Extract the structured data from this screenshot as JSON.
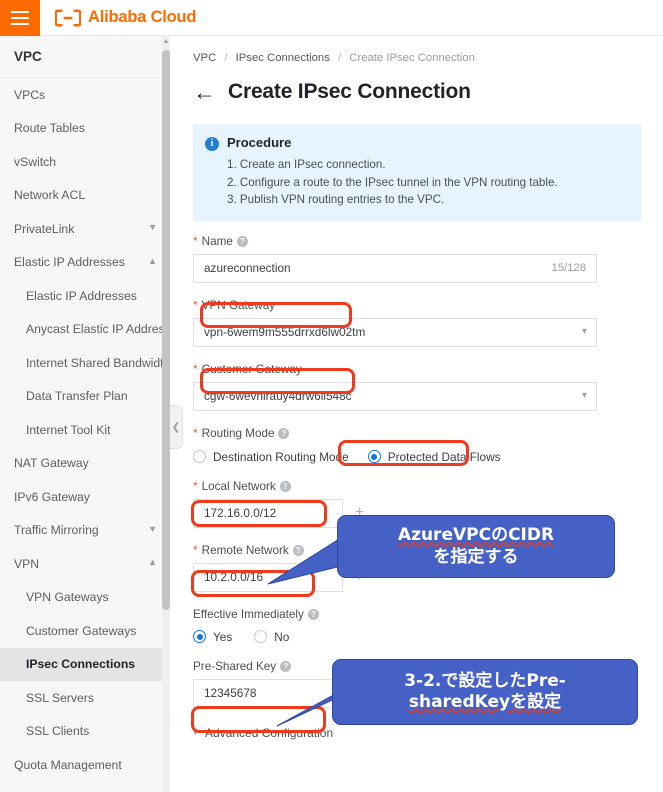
{
  "topbar": {
    "menu_icon": "hamburger-icon",
    "logo_icon": "alibaba-cloud-logo",
    "brand": "Alibaba Cloud"
  },
  "sidebar": {
    "title": "VPC",
    "items": [
      {
        "label": "VPCs",
        "level": 1,
        "expandable": false,
        "active": false
      },
      {
        "label": "Route Tables",
        "level": 1,
        "expandable": false,
        "active": false
      },
      {
        "label": "vSwitch",
        "level": 1,
        "expandable": false,
        "active": false
      },
      {
        "label": "Network ACL",
        "level": 1,
        "expandable": false,
        "active": false
      },
      {
        "label": "PrivateLink",
        "level": 1,
        "expandable": true,
        "expanded": false,
        "active": false
      },
      {
        "label": "Elastic IP Addresses",
        "level": 1,
        "expandable": true,
        "expanded": true,
        "active": false
      },
      {
        "label": "Elastic IP Addresses",
        "level": 2,
        "expandable": false,
        "active": false
      },
      {
        "label": "Anycast Elastic IP Addresses",
        "level": 2,
        "expandable": false,
        "active": false
      },
      {
        "label": "Internet Shared Bandwidth",
        "level": 2,
        "expandable": false,
        "active": false
      },
      {
        "label": "Data Transfer Plan",
        "level": 2,
        "expandable": false,
        "active": false
      },
      {
        "label": "Internet Tool Kit",
        "level": 2,
        "expandable": false,
        "active": false
      },
      {
        "label": "NAT Gateway",
        "level": 1,
        "expandable": false,
        "active": false
      },
      {
        "label": "IPv6 Gateway",
        "level": 1,
        "expandable": false,
        "active": false
      },
      {
        "label": "Traffic Mirroring",
        "level": 1,
        "expandable": true,
        "expanded": false,
        "active": false
      },
      {
        "label": "VPN",
        "level": 1,
        "expandable": true,
        "expanded": true,
        "active": false
      },
      {
        "label": "VPN Gateways",
        "level": 2,
        "expandable": false,
        "active": false
      },
      {
        "label": "Customer Gateways",
        "level": 2,
        "expandable": false,
        "active": false
      },
      {
        "label": "IPsec Connections",
        "level": 2,
        "expandable": false,
        "active": true
      },
      {
        "label": "SSL Servers",
        "level": 2,
        "expandable": false,
        "active": false
      },
      {
        "label": "SSL Clients",
        "level": 2,
        "expandable": false,
        "active": false
      },
      {
        "label": "Quota Management",
        "level": 1,
        "expandable": false,
        "active": false
      }
    ],
    "collapse_icon": "chevron-double-left-icon"
  },
  "breadcrumb": {
    "items": [
      "VPC",
      "IPsec Connections",
      "Create IPsec Connection"
    ],
    "separator": "/"
  },
  "header": {
    "back_icon": "back-arrow-icon",
    "title": "Create IPsec Connection"
  },
  "procedure": {
    "icon": "info-icon",
    "title": "Procedure",
    "steps": [
      "1. Create an IPsec connection.",
      "2. Configure a route to the IPsec tunnel in the VPN routing table.",
      "3. Publish VPN routing entries to the VPC."
    ]
  },
  "form": {
    "name": {
      "label": "Name",
      "required": true,
      "help_icon": "question-mark-icon",
      "value": "azureconnection",
      "counter": "15/128"
    },
    "vpn_gateway": {
      "label": "VPN Gateway",
      "required": true,
      "value": "vpn-6wem9m555drrxd6lw02tm",
      "caret_icon": "chevron-down-icon"
    },
    "customer_gateway": {
      "label": "Customer Gateway",
      "required": true,
      "value": "cgw-6wevnirauy4drw6ll548c",
      "caret_icon": "chevron-down-icon"
    },
    "routing_mode": {
      "label": "Routing Mode",
      "required": true,
      "help_icon": "question-mark-icon",
      "options": [
        {
          "label": "Destination Routing Mode",
          "selected": false
        },
        {
          "label": "Protected Data Flows",
          "selected": true
        }
      ]
    },
    "local_network": {
      "label": "Local Network",
      "required": true,
      "help_icon": "question-mark-icon",
      "value": "172.16.0.0/12",
      "add_icon": "plus-icon"
    },
    "remote_network": {
      "label": "Remote Network",
      "required": true,
      "help_icon": "question-mark-icon",
      "value": "10.2.0.0/16",
      "add_icon": "plus-icon"
    },
    "effective_immediately": {
      "label": "Effective Immediately",
      "required": false,
      "help_icon": "question-mark-icon",
      "options": [
        {
          "label": "Yes",
          "selected": true
        },
        {
          "label": "No",
          "selected": false
        }
      ]
    },
    "pre_shared_key": {
      "label": "Pre-Shared Key",
      "required": false,
      "help_icon": "question-mark-icon",
      "value": "12345678"
    },
    "advanced": {
      "label": "Advanced Configuration",
      "chevron_icon": "chevron-down-icon"
    }
  },
  "annotations": {
    "accent_highlight": "#EF3B1C",
    "callout_fill": "#4661C5",
    "callout_text": "#FFFFFF",
    "callouts": [
      {
        "line1": "AzureVPCのCIDR",
        "line2": "を指定する"
      },
      {
        "line1": "3-2.で設定したPre-",
        "line2": "sharedKeyを設定"
      }
    ]
  },
  "colors": {
    "brand_orange": "#FF6A00",
    "link_blue": "#1374E0",
    "info_bg": "#E8F4FD",
    "sidebar_bg": "#F7F7F7"
  }
}
